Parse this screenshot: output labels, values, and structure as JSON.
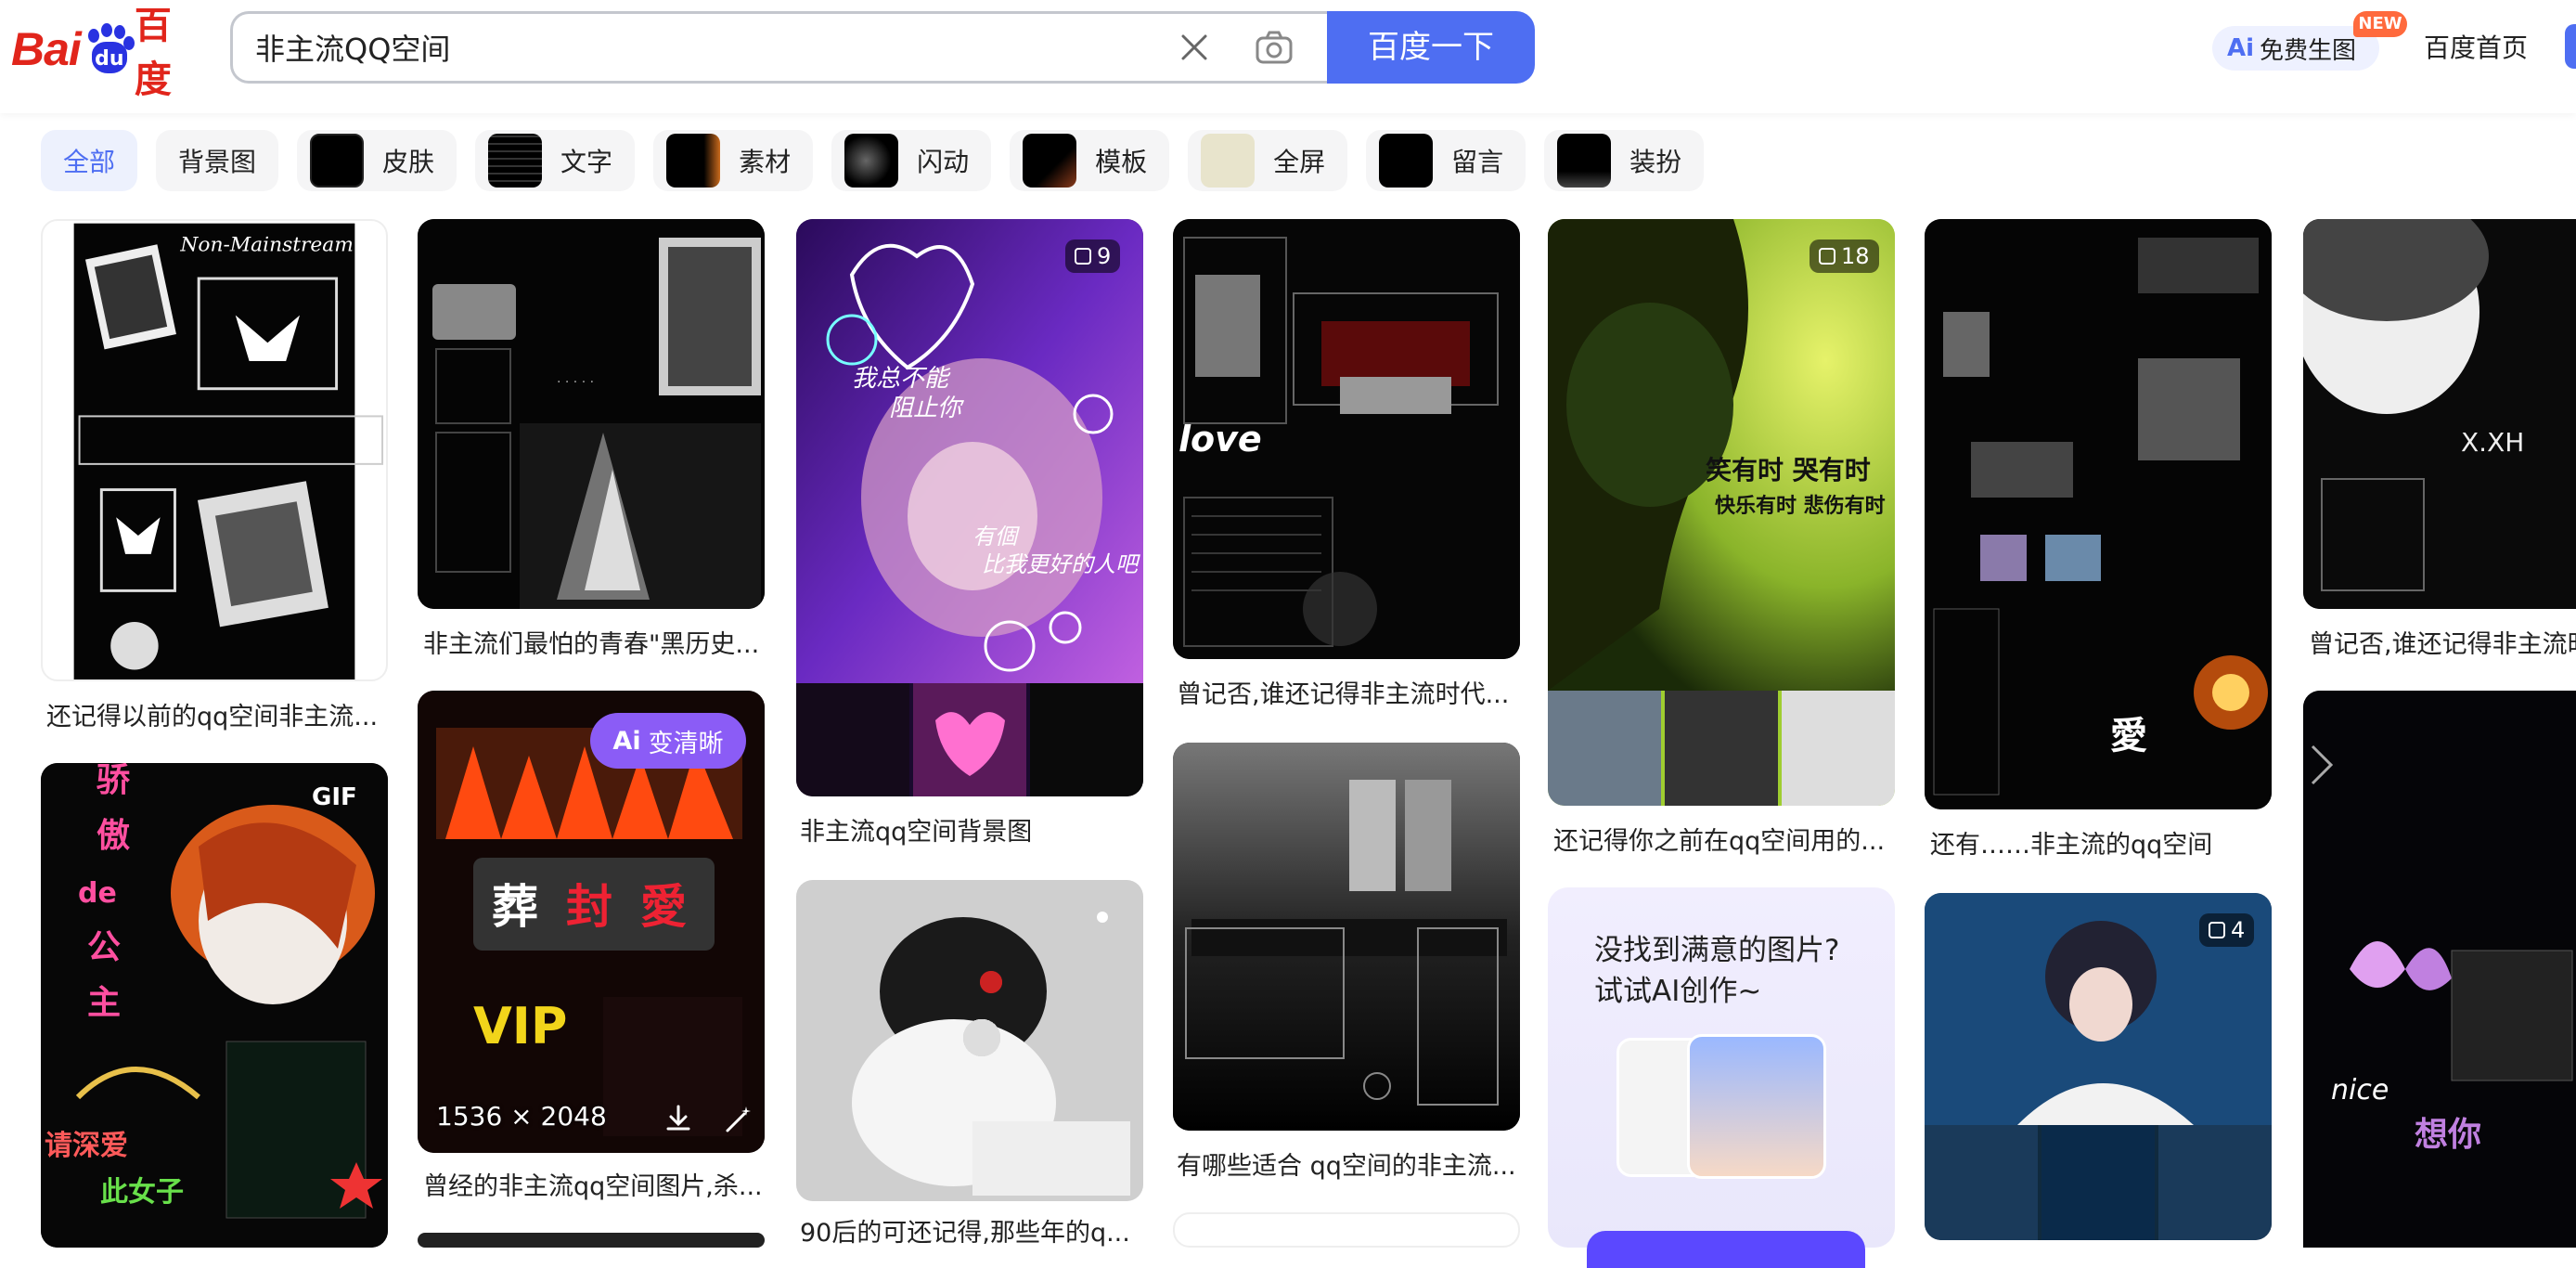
{
  "header": {
    "logo_bai": "Bai",
    "logo_du": "du",
    "logo_cn": "百度",
    "search_value": "非主流QQ空间",
    "search_button": "百度一下",
    "ai_prefix": "Ai",
    "ai_label": "免费生图",
    "new_badge": "NEW",
    "home_link": "百度首页"
  },
  "filters": [
    {
      "label": "全部"
    },
    {
      "label": "背景图"
    },
    {
      "label": "皮肤"
    },
    {
      "label": "文字"
    },
    {
      "label": "素材"
    },
    {
      "label": "闪动"
    },
    {
      "label": "模板"
    },
    {
      "label": "全屏"
    },
    {
      "label": "留言"
    },
    {
      "label": "装扮"
    }
  ],
  "results": [
    {
      "caption": "还记得以前的qq空间非主流..."
    },
    {
      "caption": "非主流们最怕的青春\"黑历史..."
    },
    {
      "caption": "非主流qq空间背景图",
      "count": "9"
    },
    {
      "caption": "曾记否,谁还记得非主流时代..."
    },
    {
      "caption": "还记得你之前在qq空间用的...",
      "count": "18"
    },
    {
      "caption": "还有……非主流的qq空间"
    },
    {
      "caption": "曾记否,谁还记得非主流时"
    },
    {
      "gif": "GIF"
    },
    {
      "caption": "曾经的非主流qq空间图片,杀...",
      "enhance_prefix": "Ai",
      "enhance": "变清晰",
      "dims": "1536 × 2048"
    },
    {
      "caption": "90后的可还记得,那些年的q..."
    },
    {
      "caption": "有哪些适合 qq空间的非主流..."
    },
    {
      "count": "4"
    }
  ],
  "ai_promo": {
    "line1": "没找到满意的图片?",
    "line2": "试试AI创作~"
  },
  "image_texts": {
    "love": "love",
    "mainstream": "Non-Mainstream",
    "vip": "VIP",
    "gif_text": "骄傲de公主"
  }
}
